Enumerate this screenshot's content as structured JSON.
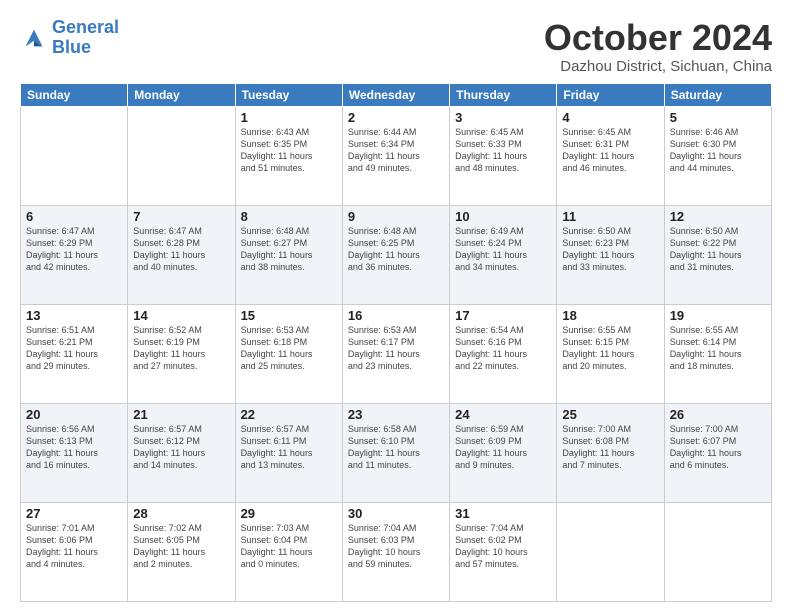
{
  "logo": {
    "line1": "General",
    "line2": "Blue"
  },
  "title": "October 2024",
  "subtitle": "Dazhou District, Sichuan, China",
  "headers": [
    "Sunday",
    "Monday",
    "Tuesday",
    "Wednesday",
    "Thursday",
    "Friday",
    "Saturday"
  ],
  "weeks": [
    [
      {
        "day": "",
        "info": ""
      },
      {
        "day": "",
        "info": ""
      },
      {
        "day": "1",
        "info": "Sunrise: 6:43 AM\nSunset: 6:35 PM\nDaylight: 11 hours\nand 51 minutes."
      },
      {
        "day": "2",
        "info": "Sunrise: 6:44 AM\nSunset: 6:34 PM\nDaylight: 11 hours\nand 49 minutes."
      },
      {
        "day": "3",
        "info": "Sunrise: 6:45 AM\nSunset: 6:33 PM\nDaylight: 11 hours\nand 48 minutes."
      },
      {
        "day": "4",
        "info": "Sunrise: 6:45 AM\nSunset: 6:31 PM\nDaylight: 11 hours\nand 46 minutes."
      },
      {
        "day": "5",
        "info": "Sunrise: 6:46 AM\nSunset: 6:30 PM\nDaylight: 11 hours\nand 44 minutes."
      }
    ],
    [
      {
        "day": "6",
        "info": "Sunrise: 6:47 AM\nSunset: 6:29 PM\nDaylight: 11 hours\nand 42 minutes."
      },
      {
        "day": "7",
        "info": "Sunrise: 6:47 AM\nSunset: 6:28 PM\nDaylight: 11 hours\nand 40 minutes."
      },
      {
        "day": "8",
        "info": "Sunrise: 6:48 AM\nSunset: 6:27 PM\nDaylight: 11 hours\nand 38 minutes."
      },
      {
        "day": "9",
        "info": "Sunrise: 6:48 AM\nSunset: 6:25 PM\nDaylight: 11 hours\nand 36 minutes."
      },
      {
        "day": "10",
        "info": "Sunrise: 6:49 AM\nSunset: 6:24 PM\nDaylight: 11 hours\nand 34 minutes."
      },
      {
        "day": "11",
        "info": "Sunrise: 6:50 AM\nSunset: 6:23 PM\nDaylight: 11 hours\nand 33 minutes."
      },
      {
        "day": "12",
        "info": "Sunrise: 6:50 AM\nSunset: 6:22 PM\nDaylight: 11 hours\nand 31 minutes."
      }
    ],
    [
      {
        "day": "13",
        "info": "Sunrise: 6:51 AM\nSunset: 6:21 PM\nDaylight: 11 hours\nand 29 minutes."
      },
      {
        "day": "14",
        "info": "Sunrise: 6:52 AM\nSunset: 6:19 PM\nDaylight: 11 hours\nand 27 minutes."
      },
      {
        "day": "15",
        "info": "Sunrise: 6:53 AM\nSunset: 6:18 PM\nDaylight: 11 hours\nand 25 minutes."
      },
      {
        "day": "16",
        "info": "Sunrise: 6:53 AM\nSunset: 6:17 PM\nDaylight: 11 hours\nand 23 minutes."
      },
      {
        "day": "17",
        "info": "Sunrise: 6:54 AM\nSunset: 6:16 PM\nDaylight: 11 hours\nand 22 minutes."
      },
      {
        "day": "18",
        "info": "Sunrise: 6:55 AM\nSunset: 6:15 PM\nDaylight: 11 hours\nand 20 minutes."
      },
      {
        "day": "19",
        "info": "Sunrise: 6:55 AM\nSunset: 6:14 PM\nDaylight: 11 hours\nand 18 minutes."
      }
    ],
    [
      {
        "day": "20",
        "info": "Sunrise: 6:56 AM\nSunset: 6:13 PM\nDaylight: 11 hours\nand 16 minutes."
      },
      {
        "day": "21",
        "info": "Sunrise: 6:57 AM\nSunset: 6:12 PM\nDaylight: 11 hours\nand 14 minutes."
      },
      {
        "day": "22",
        "info": "Sunrise: 6:57 AM\nSunset: 6:11 PM\nDaylight: 11 hours\nand 13 minutes."
      },
      {
        "day": "23",
        "info": "Sunrise: 6:58 AM\nSunset: 6:10 PM\nDaylight: 11 hours\nand 11 minutes."
      },
      {
        "day": "24",
        "info": "Sunrise: 6:59 AM\nSunset: 6:09 PM\nDaylight: 11 hours\nand 9 minutes."
      },
      {
        "day": "25",
        "info": "Sunrise: 7:00 AM\nSunset: 6:08 PM\nDaylight: 11 hours\nand 7 minutes."
      },
      {
        "day": "26",
        "info": "Sunrise: 7:00 AM\nSunset: 6:07 PM\nDaylight: 11 hours\nand 6 minutes."
      }
    ],
    [
      {
        "day": "27",
        "info": "Sunrise: 7:01 AM\nSunset: 6:06 PM\nDaylight: 11 hours\nand 4 minutes."
      },
      {
        "day": "28",
        "info": "Sunrise: 7:02 AM\nSunset: 6:05 PM\nDaylight: 11 hours\nand 2 minutes."
      },
      {
        "day": "29",
        "info": "Sunrise: 7:03 AM\nSunset: 6:04 PM\nDaylight: 11 hours\nand 0 minutes."
      },
      {
        "day": "30",
        "info": "Sunrise: 7:04 AM\nSunset: 6:03 PM\nDaylight: 10 hours\nand 59 minutes."
      },
      {
        "day": "31",
        "info": "Sunrise: 7:04 AM\nSunset: 6:02 PM\nDaylight: 10 hours\nand 57 minutes."
      },
      {
        "day": "",
        "info": ""
      },
      {
        "day": "",
        "info": ""
      }
    ]
  ]
}
